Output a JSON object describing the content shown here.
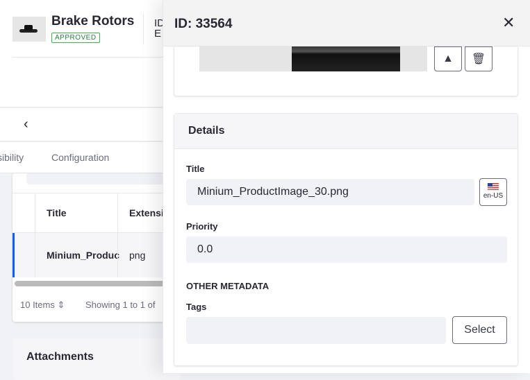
{
  "product": {
    "title": "Brake Rotors",
    "status": "APPROVED",
    "id_label": "ID",
    "extra_label": "E"
  },
  "tabs": [
    "sibility",
    "Configuration"
  ],
  "table": {
    "columns": [
      "Title",
      "Extensi"
    ],
    "rows": [
      {
        "title": "Minium_Produc",
        "extension": "png"
      }
    ],
    "items_per_page": "10 Items",
    "showing": "Showing 1 to 1 of"
  },
  "attachments_title": "Attachments",
  "panel": {
    "title": "ID: 33564",
    "details_title": "Details",
    "title_label": "Title",
    "title_value": "Minium_ProductImage_30.png",
    "locale": "en-US",
    "priority_label": "Priority",
    "priority_value": "0.0",
    "other_metadata": "OTHER METADATA",
    "tags_label": "Tags",
    "tags_value": "",
    "select_label": "Select"
  },
  "colors": {
    "accent": "#0b5fff",
    "approved": "#287d3c"
  }
}
